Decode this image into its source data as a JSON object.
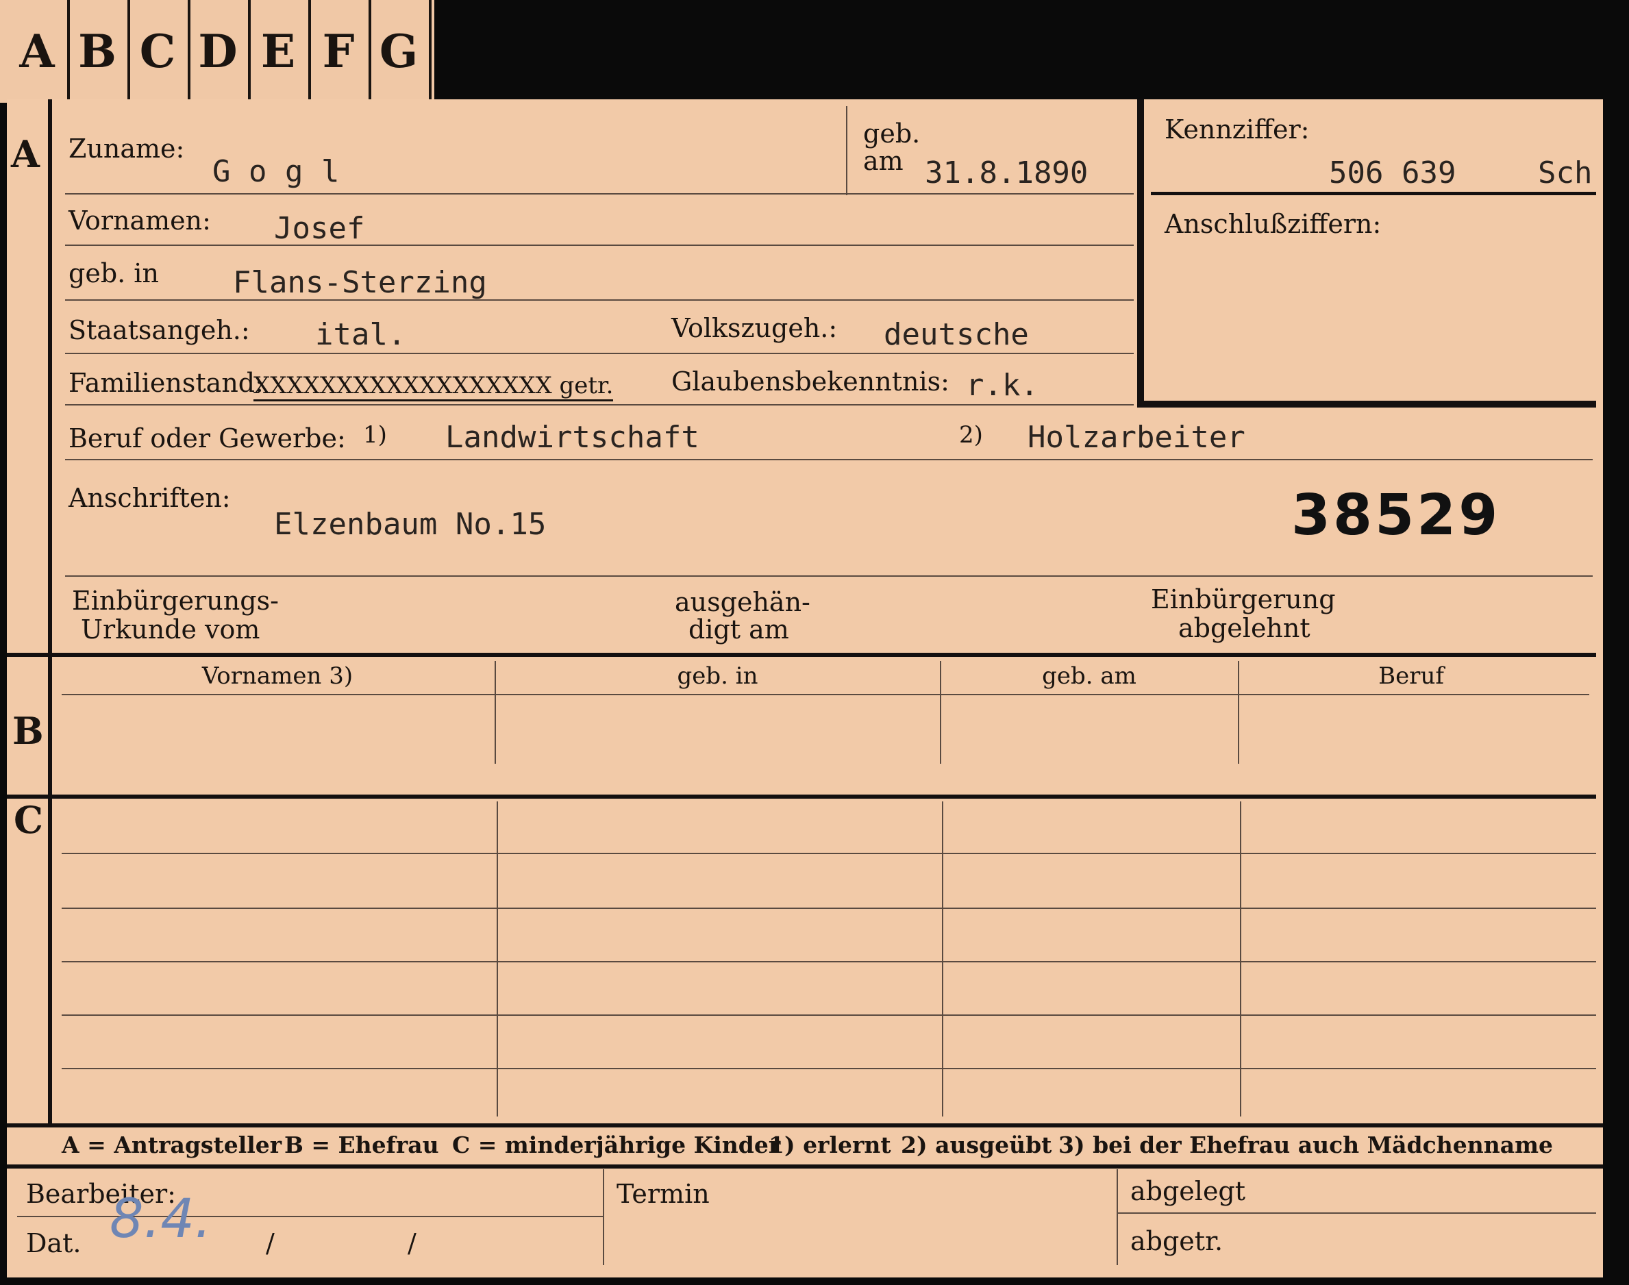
{
  "tabs": [
    "A",
    "B",
    "C",
    "D",
    "E",
    "F",
    "G"
  ],
  "sections": {
    "a": "A",
    "b": "B",
    "c": "C"
  },
  "fields": {
    "zuname_label": "Zuname:",
    "zuname_value": "G o g l",
    "geb_label_1": "geb.",
    "geb_label_2": "am",
    "geb_value": "31.8.1890",
    "vornamen_label": "Vornamen:",
    "vornamen_value": "Josef",
    "gebin_label": "geb. in",
    "gebin_value": "Flans-Sterzing",
    "staats_label": "Staatsangeh.:",
    "staats_value": "ital.",
    "volks_label": "Volkszugeh.:",
    "volks_value": "deutsche",
    "familien_label": "Familienstand:",
    "familien_value": "XXXXXXXXXXXXXXXXXX getr.",
    "glaubens_label": "Glaubensbekenntnis:",
    "glaubens_value": "r.k.",
    "beruf_label": "Beruf oder Gewerbe:",
    "beruf_mark1": "1)",
    "beruf_value1": "Landwirtschaft",
    "beruf_mark2": "2)",
    "beruf_value2": "Holzarbeiter",
    "anschriften_label": "Anschriften:",
    "anschriften_value": "Elzenbaum No.15",
    "number_stamp": "38529",
    "einb_label_1": "Einbürgerungs-",
    "einb_label_2": "Urkunde vom",
    "ausg_label_1": "ausgehän-",
    "ausg_label_2": "digt am",
    "abgel_label_1": "Einbürgerung",
    "abgel_label_2": "abgelehnt"
  },
  "kennziffer": {
    "label": "Kennziffer:",
    "value": "506 639",
    "suffix": "Sch",
    "anschluss_label": "Anschlußziffern:"
  },
  "wife_table": {
    "headers": [
      "Vornamen 3)",
      "geb. in",
      "geb. am",
      "Beruf"
    ]
  },
  "legend": {
    "a": "A = Antragsteller",
    "b": "B = Ehefrau",
    "c": "C = minderjährige Kinder",
    "n1": "1) erlernt",
    "n2": "2) ausgeübt",
    "n3": "3) bei der Ehefrau auch Mädchenname"
  },
  "footer": {
    "bearbeiter_label": "Bearbeiter:",
    "dat_label": "Dat.",
    "dat_value": "8.4.",
    "slash1": "/",
    "slash2": "/",
    "termin_label": "Termin",
    "abgelegt_label": "abgelegt",
    "abgetr_label": "abgetr."
  }
}
